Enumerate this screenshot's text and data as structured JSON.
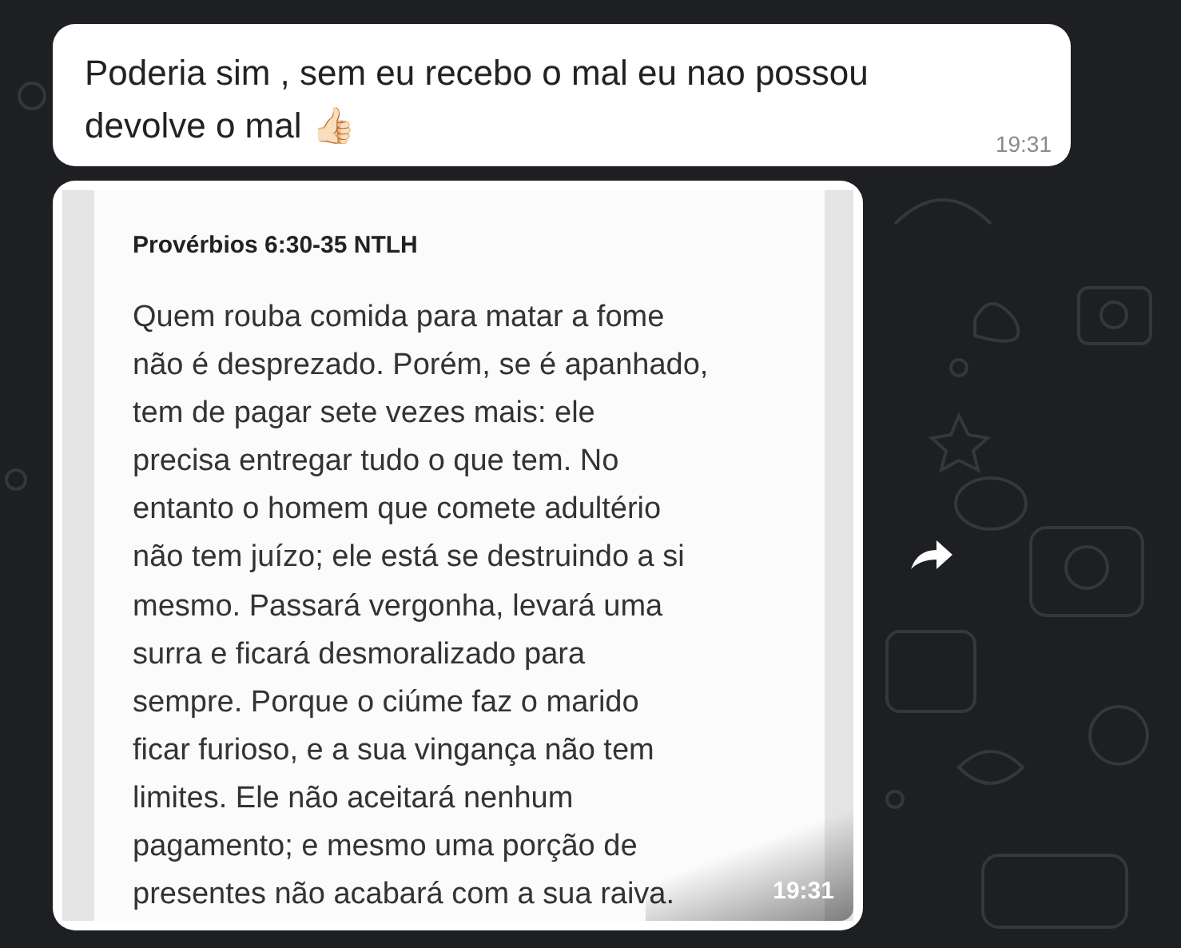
{
  "messages": [
    {
      "kind": "text",
      "text": "Poderia sim , sem eu recebo o mal eu nao possou devolve o mal 👍🏻",
      "time": "19:31"
    },
    {
      "kind": "image",
      "title": "Provérbios 6:30-35 NTLH",
      "lines": [
        "Quem rouba comida para matar a fome",
        "não é desprezado. Porém, se é apanhado,",
        "tem de pagar sete vezes mais: ele",
        "precisa entregar tudo o que tem. No",
        "entanto o homem que comete adultério",
        "não tem juízo; ele está se destruindo a si",
        "mesmo. Passará vergonha, levará uma",
        "surra e ficará desmoralizado para",
        "sempre. Porque o ciúme faz o marido",
        "ficar furioso, e a sua vingança não tem",
        "limites. Ele não aceitará nenhum",
        "pagamento; e mesmo uma porção de",
        "presentes não acabará com a sua raiva."
      ],
      "time": "19:31"
    }
  ]
}
